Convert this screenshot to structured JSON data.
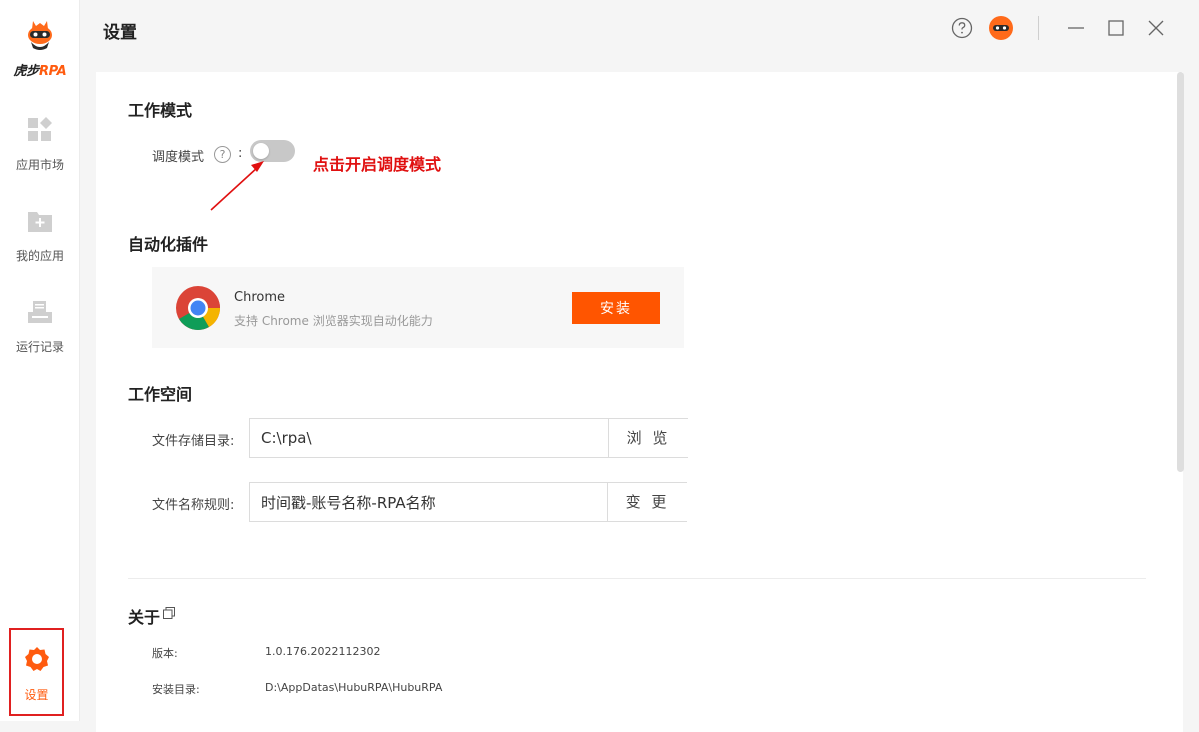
{
  "app": {
    "logo_cn": "虎步",
    "logo_rpa": "RPA",
    "brand_color": "#ff5b0f"
  },
  "sidebar": {
    "items": [
      {
        "label": "应用市场",
        "icon": "apps-grid-icon"
      },
      {
        "label": "我的应用",
        "icon": "folder-add-icon"
      },
      {
        "label": "运行记录",
        "icon": "run-log-icon"
      }
    ],
    "settings": {
      "label": "设置",
      "icon": "gear-icon"
    }
  },
  "header": {
    "title": "设置",
    "icons": [
      "help-icon",
      "avatar",
      "minimize-icon",
      "maximize-icon",
      "close-icon"
    ]
  },
  "work_mode": {
    "title": "工作模式",
    "dispatch_label": "调度模式",
    "colon": ":",
    "help_glyph": "?",
    "dispatch_enabled": false,
    "annotation": "点击开启调度模式",
    "annotation_color": "#e01010"
  },
  "plugins": {
    "title": "自动化插件",
    "items": [
      {
        "name": "Chrome",
        "description": "支持 Chrome 浏览器实现自动化能力",
        "button_label": "安装",
        "icon": "chrome-icon"
      }
    ]
  },
  "workspace": {
    "title": "工作空间",
    "storage_label": "文件存储目录:",
    "storage_value": "C:\\rpa\\",
    "browse_label": "浏 览",
    "naming_label": "文件名称规则:",
    "naming_value": "时间戳-账号名称-RPA名称",
    "change_label": "变 更"
  },
  "about": {
    "title": "关于",
    "rows": [
      {
        "label": "版本:",
        "value": "1.0.176.2022112302"
      },
      {
        "label": "安装目录:",
        "value": "D:\\AppDatas\\HubuRPA\\HubuRPA"
      }
    ]
  }
}
